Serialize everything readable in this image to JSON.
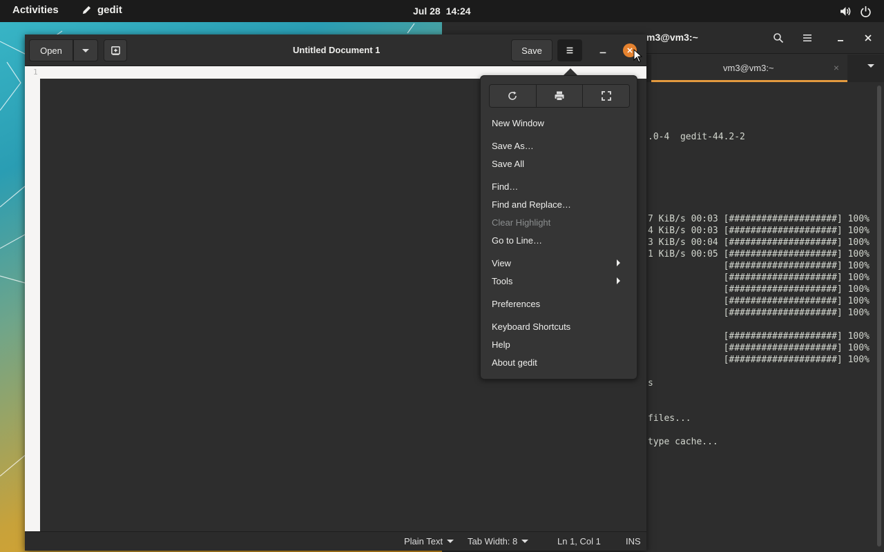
{
  "topbar": {
    "activities": "Activities",
    "app_name": "gedit",
    "date": "Jul 28",
    "time": "14:24",
    "icons": [
      "pencil-icon",
      "volume-icon",
      "power-icon"
    ]
  },
  "terminal": {
    "title": "m3@vm3:~",
    "tab_label": "vm3@vm3:~",
    "tab_close": "×",
    "accent_color": "#e39a3f",
    "lines": [
      ".0-4  gedit-44.2-2",
      "7 KiB/s 00:03 [####################] 100%",
      "4 KiB/s 00:03 [####################] 100%",
      "3 KiB/s 00:04 [####################] 100%",
      "1 KiB/s 00:05 [####################] 100%",
      "              [####################] 100%",
      "              [####################] 100%",
      "              [####################] 100%",
      "              [####################] 100%",
      "              [####################] 100%",
      "              [####################] 100%",
      "              [####################] 100%",
      "              [####################] 100%",
      "s",
      "files...",
      "type cache..."
    ]
  },
  "gedit": {
    "open_label": "Open",
    "save_label": "Save",
    "title": "Untitled Document 1",
    "line_number": "1",
    "close_color": "#e5822f",
    "statusbar": {
      "language": "Plain Text",
      "tab_width": "Tab Width: 8",
      "position": "Ln 1, Col 1",
      "mode": "INS"
    }
  },
  "menu": {
    "items": [
      {
        "label": "New Window"
      },
      {
        "label": "Save As…"
      },
      {
        "label": "Save All"
      },
      {
        "label": "Find…"
      },
      {
        "label": "Find and Replace…"
      },
      {
        "label": "Clear Highlight"
      },
      {
        "label": "Go to Line…"
      },
      {
        "label": "View"
      },
      {
        "label": "Tools"
      },
      {
        "label": "Preferences"
      },
      {
        "label": "Keyboard Shortcuts"
      },
      {
        "label": "Help"
      },
      {
        "label": "About gedit"
      }
    ],
    "toolbar_icons": [
      "reload-icon",
      "print-icon",
      "fullscreen-icon"
    ]
  }
}
